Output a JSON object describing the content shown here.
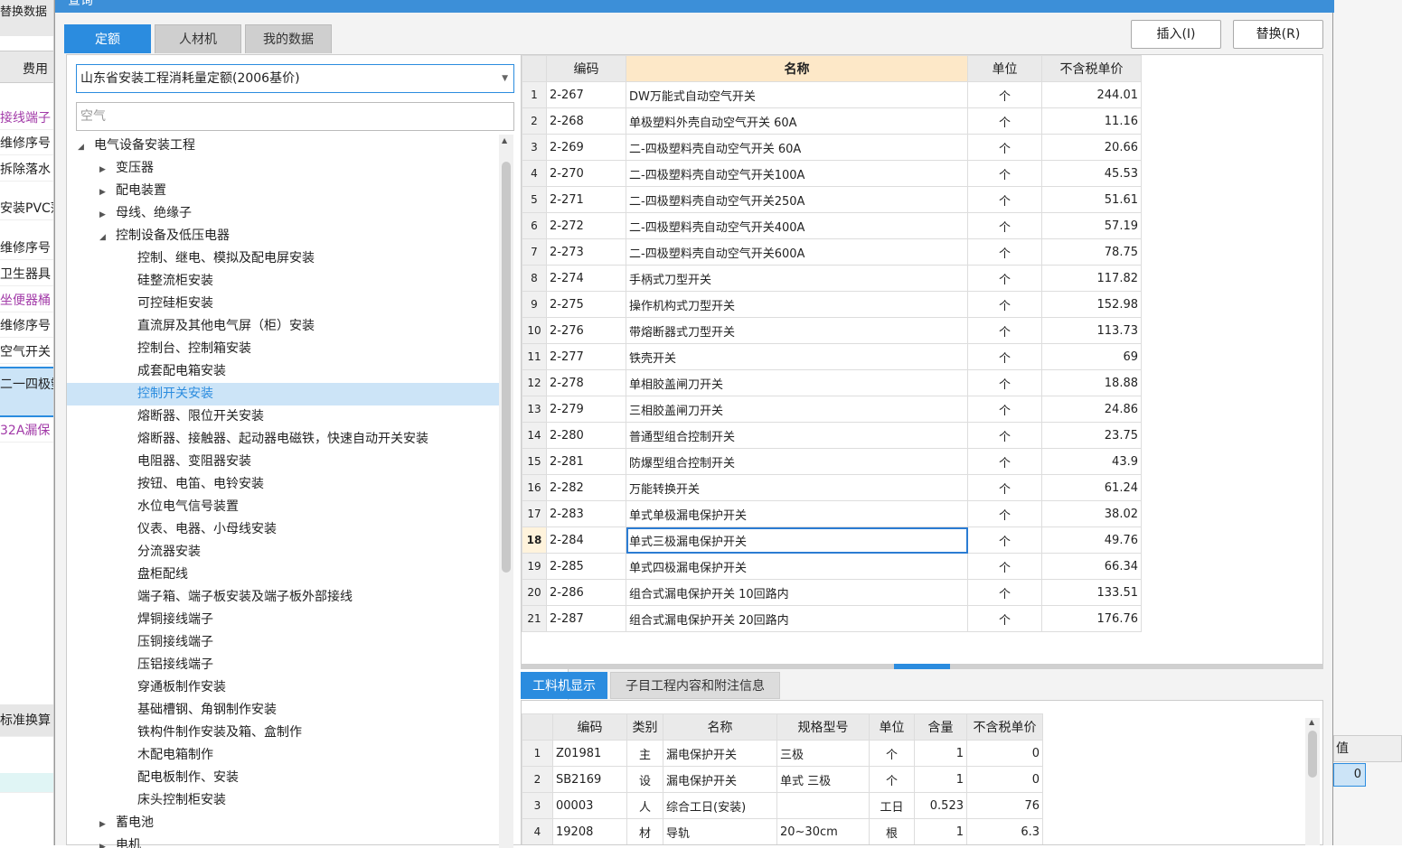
{
  "background": {
    "header": "替换数据",
    "column": "费用",
    "rows": [
      "接线端子",
      "维修序号",
      "拆除落水",
      "安装PVC落",
      "维修序号",
      "卫生器具",
      "坐便器桶",
      "维修序号",
      "空气开关",
      "二一四极塑",
      "32A漏保"
    ],
    "bottom_label": "标准换算",
    "right_label": "值",
    "right_value": "0"
  },
  "dialog": {
    "title": "查询",
    "tabs": [
      "定额",
      "人材机",
      "我的数据"
    ],
    "buttons": {
      "insert": "插入(I)",
      "replace": "替换(R)"
    },
    "quota_select": "山东省安装工程消耗量定额(2006基价)",
    "search_value": "空气",
    "tree": [
      {
        "label": "电气设备安装工程",
        "level": 0,
        "state": "expanded"
      },
      {
        "label": "变压器",
        "level": 1,
        "state": "collapsed"
      },
      {
        "label": "配电装置",
        "level": 1,
        "state": "collapsed"
      },
      {
        "label": "母线、绝缘子",
        "level": 1,
        "state": "collapsed"
      },
      {
        "label": "控制设备及低压电器",
        "level": 1,
        "state": "expanded"
      },
      {
        "label": "控制、继电、模拟及配电屏安装",
        "level": 2,
        "state": "leaf"
      },
      {
        "label": "硅整流柜安装",
        "level": 2,
        "state": "leaf"
      },
      {
        "label": "可控硅柜安装",
        "level": 2,
        "state": "leaf"
      },
      {
        "label": "直流屏及其他电气屏（柜）安装",
        "level": 2,
        "state": "leaf"
      },
      {
        "label": "控制台、控制箱安装",
        "level": 2,
        "state": "leaf"
      },
      {
        "label": "成套配电箱安装",
        "level": 2,
        "state": "leaf"
      },
      {
        "label": "控制开关安装",
        "level": 2,
        "state": "leaf",
        "selected": true
      },
      {
        "label": "熔断器、限位开关安装",
        "level": 2,
        "state": "leaf"
      },
      {
        "label": "熔断器、接触器、起动器电磁铁，快速自动开关安装",
        "level": 2,
        "state": "leaf"
      },
      {
        "label": "电阻器、变阻器安装",
        "level": 2,
        "state": "leaf"
      },
      {
        "label": "按钮、电笛、电铃安装",
        "level": 2,
        "state": "leaf"
      },
      {
        "label": "水位电气信号装置",
        "level": 2,
        "state": "leaf"
      },
      {
        "label": "仪表、电器、小母线安装",
        "level": 2,
        "state": "leaf"
      },
      {
        "label": "分流器安装",
        "level": 2,
        "state": "leaf"
      },
      {
        "label": "盘柜配线",
        "level": 2,
        "state": "leaf"
      },
      {
        "label": "端子箱、端子板安装及端子板外部接线",
        "level": 2,
        "state": "leaf"
      },
      {
        "label": "焊铜接线端子",
        "level": 2,
        "state": "leaf"
      },
      {
        "label": "压铜接线端子",
        "level": 2,
        "state": "leaf"
      },
      {
        "label": "压铝接线端子",
        "level": 2,
        "state": "leaf"
      },
      {
        "label": "穿通板制作安装",
        "level": 2,
        "state": "leaf"
      },
      {
        "label": "基础槽钢、角钢制作安装",
        "level": 2,
        "state": "leaf"
      },
      {
        "label": "铁构件制作安装及箱、盒制作",
        "level": 2,
        "state": "leaf"
      },
      {
        "label": "木配电箱制作",
        "level": 2,
        "state": "leaf"
      },
      {
        "label": "配电板制作、安装",
        "level": 2,
        "state": "leaf"
      },
      {
        "label": "床头控制柜安装",
        "level": 2,
        "state": "leaf"
      },
      {
        "label": "蓄电池",
        "level": 1,
        "state": "collapsed"
      },
      {
        "label": "电机",
        "level": 1,
        "state": "collapsed"
      }
    ],
    "main_table": {
      "headers": [
        "编码",
        "名称",
        "单位",
        "不含税单价"
      ],
      "current_row": 18,
      "rows": [
        [
          "1",
          "2-267",
          "DW万能式自动空气开关",
          "个",
          "244.01"
        ],
        [
          "2",
          "2-268",
          "单极塑料外壳自动空气开关 60A",
          "个",
          "11.16"
        ],
        [
          "3",
          "2-269",
          "二-四极塑料壳自动空气开关 60A",
          "个",
          "20.66"
        ],
        [
          "4",
          "2-270",
          "二-四极塑料壳自动空气开关100A",
          "个",
          "45.53"
        ],
        [
          "5",
          "2-271",
          "二-四极塑料壳自动空气开关250A",
          "个",
          "51.61"
        ],
        [
          "6",
          "2-272",
          "二-四极塑料壳自动空气开关400A",
          "个",
          "57.19"
        ],
        [
          "7",
          "2-273",
          "二-四极塑料壳自动空气开关600A",
          "个",
          "78.75"
        ],
        [
          "8",
          "2-274",
          "手柄式刀型开关",
          "个",
          "117.82"
        ],
        [
          "9",
          "2-275",
          "操作机构式刀型开关",
          "个",
          "152.98"
        ],
        [
          "10",
          "2-276",
          "带熔断器式刀型开关",
          "个",
          "113.73"
        ],
        [
          "11",
          "2-277",
          "铁壳开关",
          "个",
          "69"
        ],
        [
          "12",
          "2-278",
          "单相胶盖闸刀开关",
          "个",
          "18.88"
        ],
        [
          "13",
          "2-279",
          "三相胶盖闸刀开关",
          "个",
          "24.86"
        ],
        [
          "14",
          "2-280",
          "普通型组合控制开关",
          "个",
          "23.75"
        ],
        [
          "15",
          "2-281",
          "防爆型组合控制开关",
          "个",
          "43.9"
        ],
        [
          "16",
          "2-282",
          "万能转换开关",
          "个",
          "61.24"
        ],
        [
          "17",
          "2-283",
          "单式单极漏电保护开关",
          "个",
          "38.02"
        ],
        [
          "18",
          "2-284",
          "单式三极漏电保护开关",
          "个",
          "49.76"
        ],
        [
          "19",
          "2-285",
          "单式四极漏电保护开关",
          "个",
          "66.34"
        ],
        [
          "20",
          "2-286",
          "组合式漏电保护开关 10回路内",
          "个",
          "133.51"
        ],
        [
          "21",
          "2-287",
          "组合式漏电保护开关 20回路内",
          "个",
          "176.76"
        ]
      ]
    },
    "bottom_tabs": [
      "工料机显示",
      "子目工程内容和附注信息"
    ],
    "detail_table": {
      "headers": [
        "编码",
        "类别",
        "名称",
        "规格型号",
        "单位",
        "含量",
        "不含税单价"
      ],
      "rows": [
        [
          "1",
          "Z01981",
          "主",
          "漏电保护开关",
          "三极",
          "个",
          "1",
          "0"
        ],
        [
          "2",
          "SB2169",
          "设",
          "漏电保护开关",
          "单式 三极",
          "个",
          "1",
          "0"
        ],
        [
          "3",
          "00003",
          "人",
          "综合工日(安装)",
          "",
          "工日",
          "0.523",
          "76"
        ],
        [
          "4",
          "19208",
          "材",
          "导轨",
          "20~30cm",
          "根",
          "1",
          "6.3"
        ]
      ]
    }
  }
}
